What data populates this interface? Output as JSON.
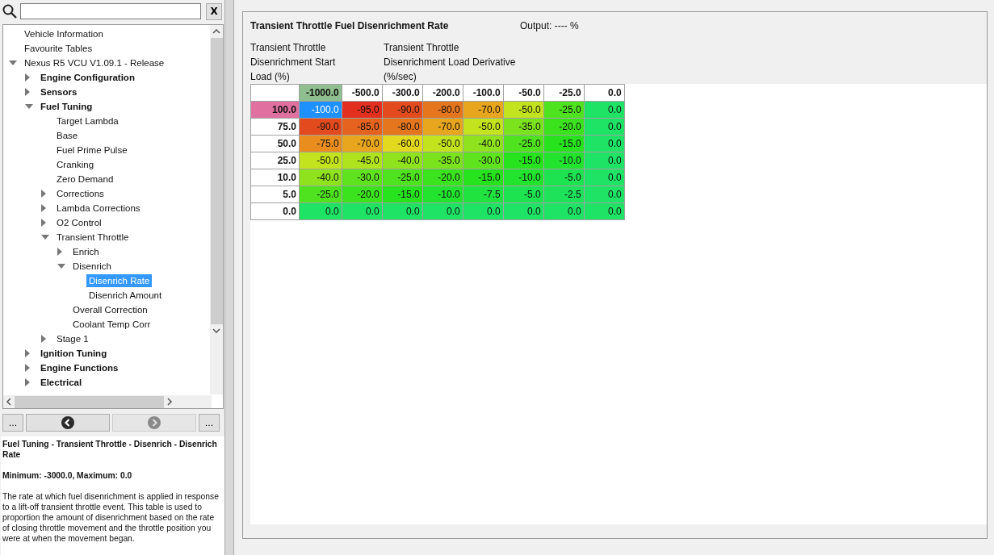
{
  "search": {
    "clear_button": "X"
  },
  "tree": [
    {
      "label": "Vehicle Information",
      "selected": false
    },
    {
      "label": "Favourite Tables",
      "selected": false
    },
    {
      "label": "Nexus R5 VCU V1.09.1 - Release",
      "selected": false,
      "expanded": true,
      "children": [
        {
          "label": "Engine Configuration",
          "selected": false,
          "expanded": false
        },
        {
          "label": "Sensors",
          "selected": false,
          "expanded": false
        },
        {
          "label": "Fuel Tuning",
          "selected": false,
          "expanded": true,
          "children": [
            {
              "label": "Target Lambda",
              "selected": false
            },
            {
              "label": "Base",
              "selected": false
            },
            {
              "label": "Fuel Prime Pulse",
              "selected": false
            },
            {
              "label": "Cranking",
              "selected": false
            },
            {
              "label": "Zero Demand",
              "selected": false
            },
            {
              "label": "Corrections",
              "selected": false,
              "expanded": false
            },
            {
              "label": "Lambda Corrections",
              "selected": false,
              "expanded": false
            },
            {
              "label": "O2 Control",
              "selected": false,
              "expanded": false
            },
            {
              "label": "Transient Throttle",
              "selected": false,
              "expanded": true,
              "children": [
                {
                  "label": "Enrich",
                  "selected": false,
                  "expanded": false
                },
                {
                  "label": "Disenrich",
                  "selected": false,
                  "expanded": true,
                  "children": [
                    {
                      "label": "Disenrich Rate",
                      "selected": true
                    },
                    {
                      "label": "Disenrich Amount",
                      "selected": false
                    }
                  ]
                },
                {
                  "label": "Overall Correction",
                  "selected": false
                },
                {
                  "label": "Coolant Temp Corr",
                  "selected": false
                }
              ]
            },
            {
              "label": "Stage 1",
              "selected": false,
              "expanded": false
            }
          ]
        },
        {
          "label": "Ignition Tuning",
          "selected": false,
          "expanded": false
        },
        {
          "label": "Engine Functions",
          "selected": false,
          "expanded": false
        },
        {
          "label": "Electrical",
          "selected": false,
          "expanded": false
        }
      ]
    }
  ],
  "nav_buttons": {
    "left": "...",
    "right": "..."
  },
  "description": {
    "path": "Fuel Tuning - Transient Throttle - Disenrich - Disenrich Rate",
    "range": "Minimum: -3000.0, Maximum: 0.0",
    "text": "The rate at which fuel disenrichment is applied in response to a lift-off transient throttle event. This table is used to proportion the amount of disenrichment based on the rate of closing throttle movement and the throttle position you were at when the movement began."
  },
  "table_view": {
    "title": "Transient Throttle Fuel Disenrichment Rate",
    "output": "Output: ---- %",
    "row_axis_label": [
      "Transient Throttle",
      "Disenrichment Start",
      "Load (%)"
    ],
    "column_axis_label": [
      "Transient Throttle",
      "Disenrichment Load Derivative",
      "(%/sec)"
    ],
    "columns": [
      {
        "label": "-1000.0",
        "selected": true
      },
      {
        "label": "-500.0",
        "selected": false
      },
      {
        "label": "-300.0",
        "selected": false
      },
      {
        "label": "-200.0",
        "selected": false
      },
      {
        "label": "-100.0",
        "selected": false
      },
      {
        "label": "-50.0",
        "selected": false
      },
      {
        "label": "-25.0",
        "selected": false
      },
      {
        "label": "0.0",
        "selected": false
      }
    ],
    "rows": [
      {
        "label": "100.0",
        "selected": true,
        "cells": [
          {
            "value": "-100.0",
            "color": "#1e90ff",
            "selected": true
          },
          {
            "value": "-95.0",
            "color": "#e3301e",
            "selected": false
          },
          {
            "value": "-90.0",
            "color": "#e34a1e",
            "selected": false
          },
          {
            "value": "-80.0",
            "color": "#e5761e",
            "selected": false
          },
          {
            "value": "-70.0",
            "color": "#e8a61e",
            "selected": false
          },
          {
            "value": "-50.0",
            "color": "#c2e31e",
            "selected": false
          },
          {
            "value": "-25.0",
            "color": "#4ee31e",
            "selected": false
          },
          {
            "value": "0.0",
            "color": "#1ee364",
            "selected": false
          }
        ]
      },
      {
        "label": "75.0",
        "selected": false,
        "cells": [
          {
            "value": "-90.0",
            "color": "#e34a1e",
            "selected": false
          },
          {
            "value": "-85.0",
            "color": "#e5631e",
            "selected": false
          },
          {
            "value": "-80.0",
            "color": "#e5761e",
            "selected": false
          },
          {
            "value": "-70.0",
            "color": "#e8a61e",
            "selected": false
          },
          {
            "value": "-50.0",
            "color": "#c2e31e",
            "selected": false
          },
          {
            "value": "-35.0",
            "color": "#7ae31e",
            "selected": false
          },
          {
            "value": "-20.0",
            "color": "#3ae31e",
            "selected": false
          },
          {
            "value": "0.0",
            "color": "#1ee364",
            "selected": false
          }
        ]
      },
      {
        "label": "50.0",
        "selected": false,
        "cells": [
          {
            "value": "-75.0",
            "color": "#e88d1e",
            "selected": false
          },
          {
            "value": "-70.0",
            "color": "#e8a61e",
            "selected": false
          },
          {
            "value": "-60.0",
            "color": "#e3d91e",
            "selected": false
          },
          {
            "value": "-50.0",
            "color": "#c2e31e",
            "selected": false
          },
          {
            "value": "-40.0",
            "color": "#8ee31e",
            "selected": false
          },
          {
            "value": "-25.0",
            "color": "#4ee31e",
            "selected": false
          },
          {
            "value": "-15.0",
            "color": "#26e31e",
            "selected": false
          },
          {
            "value": "0.0",
            "color": "#1ee364",
            "selected": false
          }
        ]
      },
      {
        "label": "25.0",
        "selected": false,
        "cells": [
          {
            "value": "-50.0",
            "color": "#c2e31e",
            "selected": false
          },
          {
            "value": "-45.0",
            "color": "#aee31e",
            "selected": false
          },
          {
            "value": "-40.0",
            "color": "#8ee31e",
            "selected": false
          },
          {
            "value": "-35.0",
            "color": "#7ae31e",
            "selected": false
          },
          {
            "value": "-30.0",
            "color": "#5fe31e",
            "selected": false
          },
          {
            "value": "-15.0",
            "color": "#26e31e",
            "selected": false
          },
          {
            "value": "-10.0",
            "color": "#22e32e",
            "selected": false
          },
          {
            "value": "0.0",
            "color": "#1ee364",
            "selected": false
          }
        ]
      },
      {
        "label": "10.0",
        "selected": false,
        "cells": [
          {
            "value": "-40.0",
            "color": "#8ee31e",
            "selected": false
          },
          {
            "value": "-30.0",
            "color": "#5fe31e",
            "selected": false
          },
          {
            "value": "-25.0",
            "color": "#4ee31e",
            "selected": false
          },
          {
            "value": "-20.0",
            "color": "#3ae31e",
            "selected": false
          },
          {
            "value": "-15.0",
            "color": "#26e31e",
            "selected": false
          },
          {
            "value": "-10.0",
            "color": "#22e32e",
            "selected": false
          },
          {
            "value": "-5.0",
            "color": "#1ee350",
            "selected": false
          },
          {
            "value": "0.0",
            "color": "#1ee364",
            "selected": false
          }
        ]
      },
      {
        "label": "5.0",
        "selected": false,
        "cells": [
          {
            "value": "-25.0",
            "color": "#4ee31e",
            "selected": false
          },
          {
            "value": "-20.0",
            "color": "#3ae31e",
            "selected": false
          },
          {
            "value": "-15.0",
            "color": "#26e31e",
            "selected": false
          },
          {
            "value": "-10.0",
            "color": "#22e32e",
            "selected": false
          },
          {
            "value": "-7.5",
            "color": "#20e340",
            "selected": false
          },
          {
            "value": "-5.0",
            "color": "#1ee350",
            "selected": false
          },
          {
            "value": "-2.5",
            "color": "#1ee35a",
            "selected": false
          },
          {
            "value": "0.0",
            "color": "#1ee364",
            "selected": false
          }
        ]
      },
      {
        "label": "0.0",
        "selected": false,
        "cells": [
          {
            "value": "0.0",
            "color": "#1ee364",
            "selected": false
          },
          {
            "value": "0.0",
            "color": "#1ee364",
            "selected": false
          },
          {
            "value": "0.0",
            "color": "#1ee364",
            "selected": false
          },
          {
            "value": "0.0",
            "color": "#1ee364",
            "selected": false
          },
          {
            "value": "0.0",
            "color": "#1ee364",
            "selected": false
          },
          {
            "value": "0.0",
            "color": "#1ee364",
            "selected": false
          },
          {
            "value": "0.0",
            "color": "#1ee364",
            "selected": false
          },
          {
            "value": "0.0",
            "color": "#1ee364",
            "selected": false
          }
        ]
      }
    ]
  }
}
